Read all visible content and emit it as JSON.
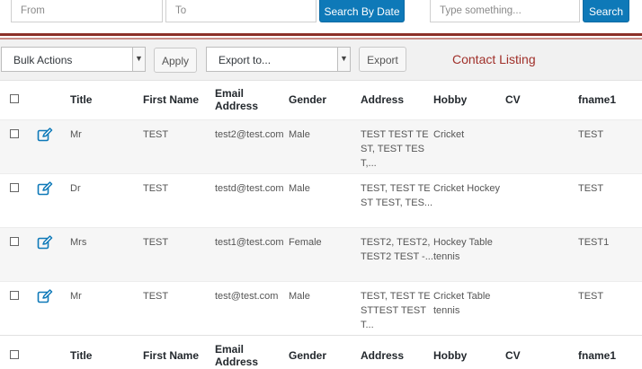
{
  "filters": {
    "from_placeholder": "From",
    "to_placeholder": "To",
    "search_by_date_label": "Search By Date",
    "search_placeholder": "Type something...",
    "search_label": "Search"
  },
  "actions": {
    "bulk_actions_label": "Bulk Actions",
    "apply_label": "Apply",
    "export_to_label": "Export to...",
    "export_label": "Export",
    "listing_title": "Contact Listing"
  },
  "colors": {
    "accent": "#0e79b8",
    "title_red": "#a0302a",
    "divider": "#8c3028"
  },
  "table": {
    "columns": [
      "Title",
      "First Name",
      "Email Address",
      "Gender",
      "Address",
      "Hobby",
      "CV",
      "fname1"
    ],
    "rows": [
      {
        "title": "Mr",
        "first_name": "TEST",
        "email": "test2@test.com",
        "gender": "Male",
        "address": "TEST TEST TEST, TEST TEST,...",
        "hobby": "Cricket",
        "cv": "",
        "fname1": "TEST"
      },
      {
        "title": "Dr",
        "first_name": "TEST",
        "email": "testd@test.com",
        "gender": "Male",
        "address": "TEST, TEST TEST TEST, TES...",
        "hobby": "Cricket Hockey",
        "cv": "",
        "fname1": "TEST"
      },
      {
        "title": "Mrs",
        "first_name": "TEST",
        "email": "test1@test.com",
        "gender": "Female",
        "address": "TEST2, TEST2, TEST2 TEST -...",
        "hobby": "Hockey Table tennis",
        "cv": "",
        "fname1": "TEST1"
      },
      {
        "title": "Mr",
        "first_name": "TEST",
        "email": "test@test.com",
        "gender": "Male",
        "address": "TEST, TEST TESTTEST TEST T...",
        "hobby": "Cricket Table tennis",
        "cv": "",
        "fname1": "TEST"
      }
    ],
    "icons": {
      "row_action": "edit-icon"
    }
  }
}
